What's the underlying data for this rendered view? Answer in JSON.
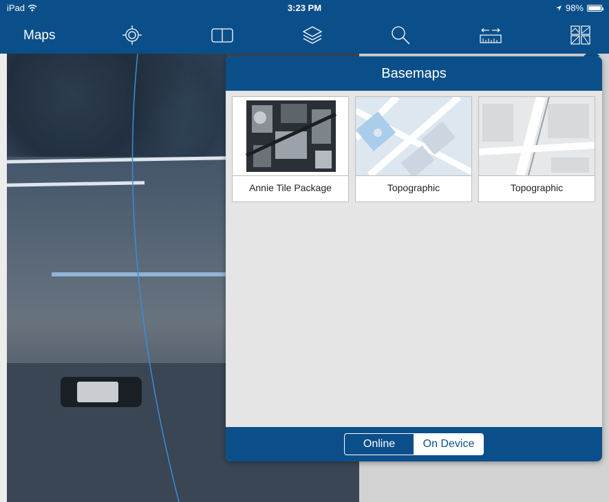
{
  "status_bar": {
    "device": "iPad",
    "wifi_icon": "wifi-icon",
    "time": "3:23 PM",
    "location_icon": "location-arrow-icon",
    "battery_text": "98%",
    "battery_level": 0.98
  },
  "toolbar": {
    "title": "Maps",
    "icons": [
      "locate-icon",
      "bookmarks-icon",
      "layers-icon",
      "search-icon",
      "measure-icon",
      "basemap-gallery-icon"
    ]
  },
  "colors": {
    "primary": "#0b4f8a",
    "popover_background": "#e5e5e5"
  },
  "basemaps_popover": {
    "title": "Basemaps",
    "tiles": [
      {
        "label": "Annie Tile Package",
        "thumbnail": "aerial-imagery"
      },
      {
        "label": "Topographic",
        "thumbnail": "topographic-map"
      },
      {
        "label": "Topographic",
        "thumbnail": "topographic-map"
      }
    ],
    "segmented_control": {
      "options": [
        "Online",
        "On Device"
      ],
      "selected": "On Device"
    }
  }
}
